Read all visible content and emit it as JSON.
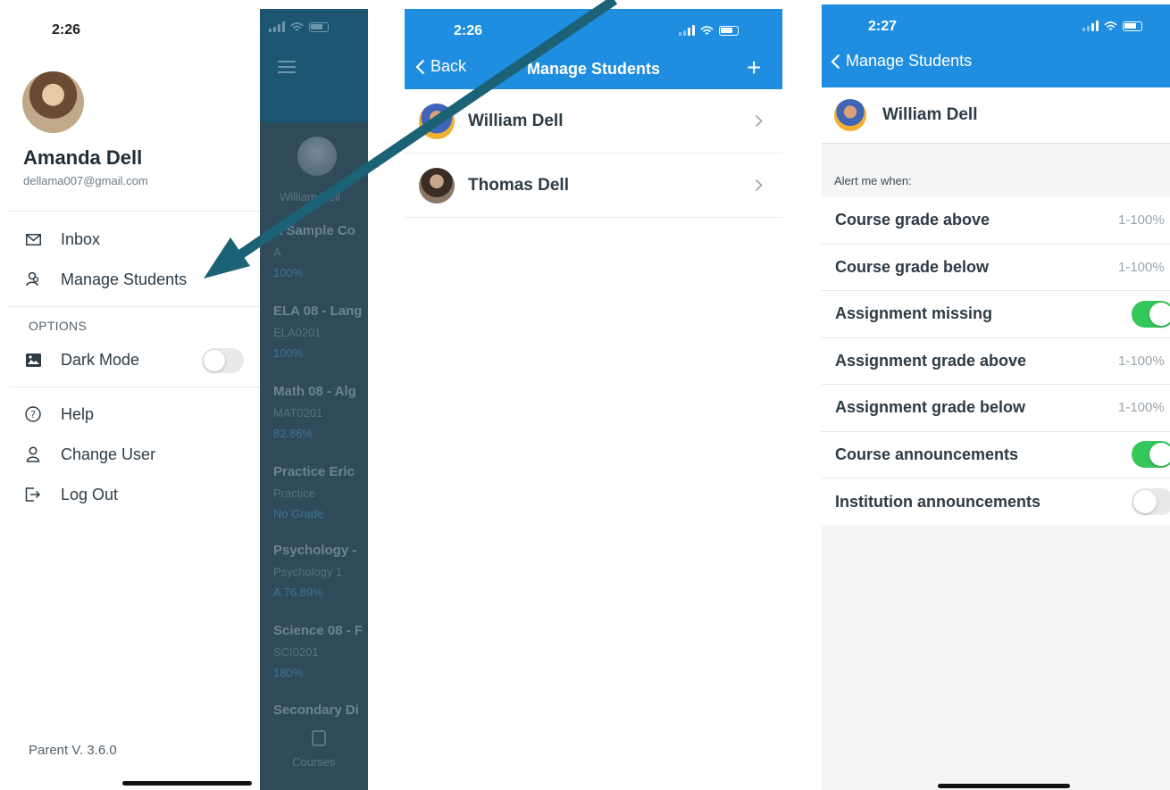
{
  "colors": {
    "nav_blue": "#1f8de0",
    "arrow": "#1b6276",
    "toggle_on": "#34c759",
    "toggle_off": "#e9e9eb"
  },
  "drawer": {
    "time": "2:26",
    "user_name": "Amanda Dell",
    "user_email": "dellama007@gmail.com",
    "menu": [
      {
        "label": "Inbox",
        "icon": "envelope-icon"
      },
      {
        "label": "Manage Students",
        "icon": "students-icon"
      }
    ],
    "options_header": "OPTIONS",
    "dark_mode": {
      "label": "Dark Mode",
      "icon": "image-icon",
      "enabled": false
    },
    "menu2": [
      {
        "label": "Help",
        "icon": "help-icon"
      },
      {
        "label": "Change User",
        "icon": "user-icon"
      },
      {
        "label": "Log Out",
        "icon": "logout-icon"
      }
    ],
    "version": "Parent V. 3.6.0"
  },
  "behind": {
    "student": "William Dell",
    "courses": [
      {
        "name": "A Sample Co",
        "code": "A",
        "grade": "100%"
      },
      {
        "name": "ELA 08 - Lang",
        "code": "ELA0201",
        "grade": "100%"
      },
      {
        "name": "Math 08 - Alg",
        "code": "MAT0201",
        "grade": "82.86%"
      },
      {
        "name": "Practice Eric",
        "code": "Practice",
        "grade": "No Grade"
      },
      {
        "name": "Psychology -",
        "code": "Psychology 1",
        "grade": "A 76.89%"
      },
      {
        "name": "Science 08 - F",
        "code": "SCI0201",
        "grade": "180%"
      },
      {
        "name": "Secondary Di",
        "code": "",
        "grade": ""
      }
    ],
    "tab_label": "Courses"
  },
  "manage": {
    "time": "2:26",
    "back_label": "Back",
    "title": "Manage Students",
    "add_label": "+",
    "students": [
      {
        "name": "William Dell"
      },
      {
        "name": "Thomas Dell"
      }
    ]
  },
  "alerts": {
    "time": "2:27",
    "back_label": "Manage Students",
    "student": "William Dell",
    "header": "Alert me when:",
    "rows": [
      {
        "label": "Course grade above",
        "type": "range",
        "value": "1-100%"
      },
      {
        "label": "Course grade below",
        "type": "range",
        "value": "1-100%"
      },
      {
        "label": "Assignment missing",
        "type": "toggle",
        "on": true
      },
      {
        "label": "Assignment grade above",
        "type": "range",
        "value": "1-100%"
      },
      {
        "label": "Assignment grade below",
        "type": "range",
        "value": "1-100%"
      },
      {
        "label": "Course announcements",
        "type": "toggle",
        "on": true
      },
      {
        "label": "Institution announcements",
        "type": "toggle",
        "on": false
      }
    ]
  }
}
